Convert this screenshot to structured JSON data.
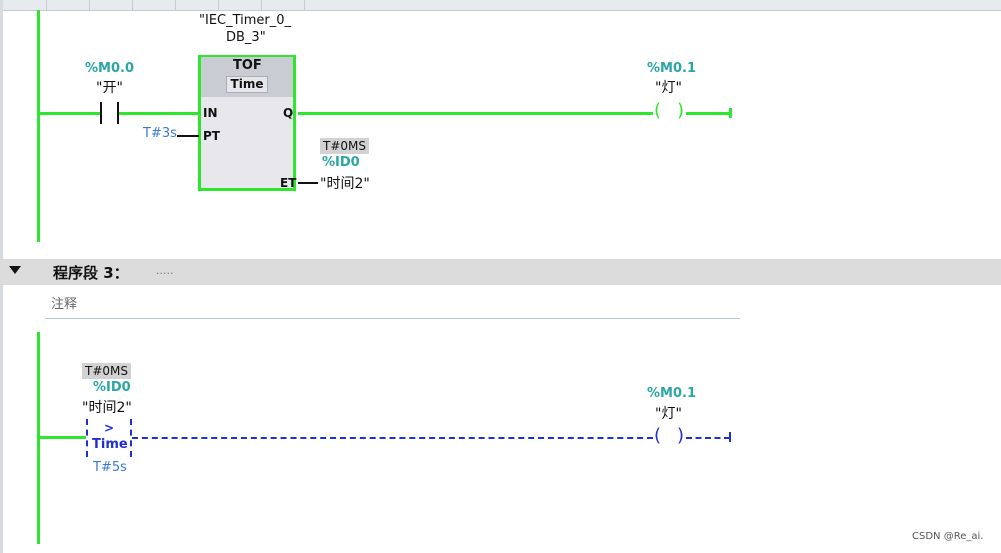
{
  "network2": {
    "timer_instance_line1": "\"IEC_Timer_0_",
    "timer_instance_line2": "DB_3\"",
    "timer_type": "TOF",
    "timer_datatype": "Time",
    "pin_in": "IN",
    "pin_q": "Q",
    "pin_pt": "PT",
    "pin_et": "ET",
    "contact_address": "%M0.0",
    "contact_name": "\"开\"",
    "pt_value": "T#3s",
    "et_monitor": "T#0MS",
    "et_address": "%ID0",
    "et_name": "\"时间2\"",
    "coil_address": "%M0.1",
    "coil_name": "\"灯\""
  },
  "segment3": {
    "title": "程序段 3：",
    "dots": ".....",
    "comment_placeholder": "注释",
    "cmp_monitor": "T#0MS",
    "cmp_address": "%ID0",
    "cmp_name": "\"时间2\"",
    "cmp_op": ">",
    "cmp_type": "Time",
    "cmp_value": "T#5s",
    "coil_address": "%M0.1",
    "coil_name": "\"灯\""
  },
  "watermark": "CSDN @Re_ai.",
  "colors": {
    "power_rail": "#2ee62e",
    "inactive": "#1f2fd0",
    "address": "#2aa6a6",
    "constant": "#3a7bd5"
  }
}
